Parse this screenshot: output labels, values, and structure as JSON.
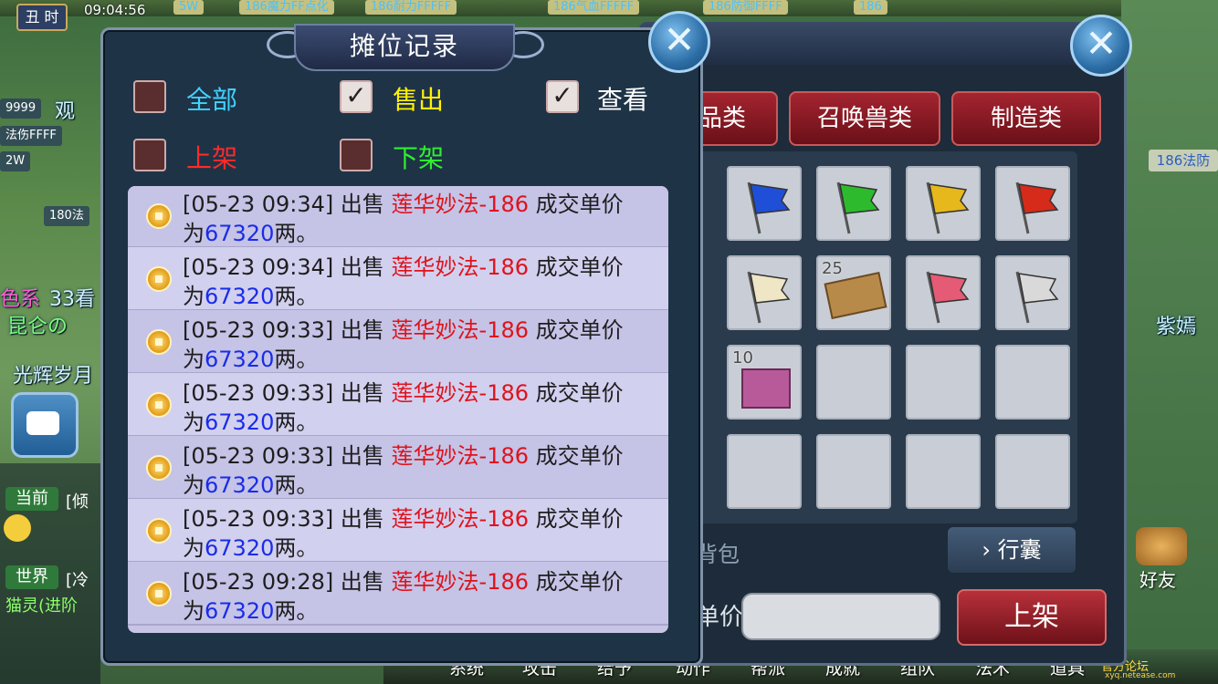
{
  "background": {
    "clock_label": "丑 时",
    "clock_time": "09:04:56",
    "top_tags": [
      "5W",
      "186魔力FF点化",
      "186耐力FFFFF",
      "186气血FFFFF",
      "186防御FFFF",
      "186"
    ],
    "left_tags": [
      "9999",
      "法伤FFFF",
      "2W",
      "180法"
    ],
    "left_words": [
      "观",
      "色系",
      "33看",
      "昆仑の",
      "光辉岁月"
    ],
    "right_tags": [
      "186法防"
    ],
    "right_words": [
      "紫嫣"
    ],
    "chat": {
      "channels": [
        {
          "label": "当前",
          "text": "[倾"
        },
        {
          "label": "世界",
          "text": "[冷"
        }
      ],
      "extra_line": "猫灵(进阶"
    },
    "bottom_menu": [
      "系统",
      "攻击",
      "给予",
      "动作",
      "帮派",
      "成就",
      "组队",
      "法术",
      "道具"
    ],
    "friend_label": "好友",
    "watermark_text": "xyq.netease.com",
    "watermark_sub": "官方论坛"
  },
  "bag_window": {
    "tabs": [
      "品类",
      "召唤兽类",
      "制造类"
    ],
    "grid": [
      {
        "icon": "blue-flag-icon",
        "count": ""
      },
      {
        "icon": "green-flag-icon",
        "count": ""
      },
      {
        "icon": "yellow-flag-icon",
        "count": ""
      },
      {
        "icon": "red-flag-icon",
        "count": ""
      },
      {
        "icon": "white-gold-flag-icon",
        "count": ""
      },
      {
        "icon": "scroll-map-icon",
        "count": "25"
      },
      {
        "icon": "pink-flag-icon",
        "count": ""
      },
      {
        "icon": "white-flag-icon",
        "count": ""
      },
      {
        "icon": "gift-box-icon",
        "count": "10"
      },
      {
        "icon": "",
        "count": ""
      },
      {
        "icon": "",
        "count": ""
      },
      {
        "icon": "",
        "count": ""
      },
      {
        "icon": "",
        "count": ""
      },
      {
        "icon": "",
        "count": ""
      },
      {
        "icon": "",
        "count": ""
      },
      {
        "icon": "",
        "count": ""
      }
    ],
    "backpack_label": "背包",
    "bag_button": "行囊",
    "price_label": "单价",
    "price_value": "",
    "shelf_button": "上架",
    "close_label": "✕"
  },
  "dialog": {
    "title": "摊位记录",
    "close_label": "✕",
    "filters": [
      {
        "label": "全部",
        "checked": false,
        "color": "#3fd3ff"
      },
      {
        "label": "售出",
        "checked": true,
        "color": "#fff200"
      },
      {
        "label": "查看",
        "checked": true,
        "color": "#ffffff"
      },
      {
        "label": "上架",
        "checked": false,
        "color": "#ff2a2a"
      },
      {
        "label": "下架",
        "checked": false,
        "color": "#2df12d"
      }
    ],
    "records": [
      {
        "time": "[05-23 09:34]",
        "action": "出售",
        "item": "莲华妙法-186",
        "suffix": "成交单价",
        "prefix2": "为",
        "price": "67320",
        "unit": "两。"
      },
      {
        "time": "[05-23 09:34]",
        "action": "出售",
        "item": "莲华妙法-186",
        "suffix": "成交单价",
        "prefix2": "为",
        "price": "67320",
        "unit": "两。"
      },
      {
        "time": "[05-23 09:33]",
        "action": "出售",
        "item": "莲华妙法-186",
        "suffix": "成交单价",
        "prefix2": "为",
        "price": "67320",
        "unit": "两。"
      },
      {
        "time": "[05-23 09:33]",
        "action": "出售",
        "item": "莲华妙法-186",
        "suffix": "成交单价",
        "prefix2": "为",
        "price": "67320",
        "unit": "两。"
      },
      {
        "time": "[05-23 09:33]",
        "action": "出售",
        "item": "莲华妙法-186",
        "suffix": "成交单价",
        "prefix2": "为",
        "price": "67320",
        "unit": "两。"
      },
      {
        "time": "[05-23 09:33]",
        "action": "出售",
        "item": "莲华妙法-186",
        "suffix": "成交单价",
        "prefix2": "为",
        "price": "67320",
        "unit": "两。"
      },
      {
        "time": "[05-23 09:28]",
        "action": "出售",
        "item": "莲华妙法-186",
        "suffix": "成交单价",
        "prefix2": "为",
        "price": "67320",
        "unit": "两。"
      }
    ]
  }
}
